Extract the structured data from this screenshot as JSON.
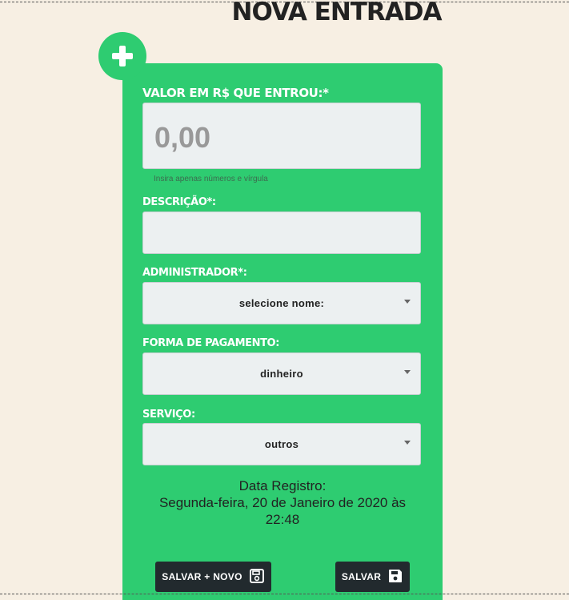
{
  "page_title": "NOVA ENTRADA",
  "form": {
    "valor_label": "VALOR EM R$ QUE ENTROU:*",
    "valor_placeholder": "0,00",
    "valor_hint": "Insira apenas números e vírgula",
    "descricao_label": "DESCRIÇÃO*:",
    "descricao_value": "",
    "administrador_label": "ADMINISTRADOR*:",
    "administrador_value": "selecione nome:",
    "forma_label": "FORMA DE PAGAMENTO:",
    "forma_value": "dinheiro",
    "servico_label": "SERVIÇO:",
    "servico_value": "outros"
  },
  "registro": {
    "heading": "Data Registro:",
    "date_line": "Segunda-feira, 20 de Janeiro de 2020 às",
    "time_line": "22:48"
  },
  "buttons": {
    "save_new": "SALVAR + NOVO",
    "save": "SALVAR"
  },
  "icons": {
    "badge": "plus-icon",
    "save_new": "floppy-outline-icon",
    "save": "floppy-icon"
  },
  "colors": {
    "accent": "#2ecc71",
    "background": "#f7efe3",
    "button": "#222a2e"
  }
}
